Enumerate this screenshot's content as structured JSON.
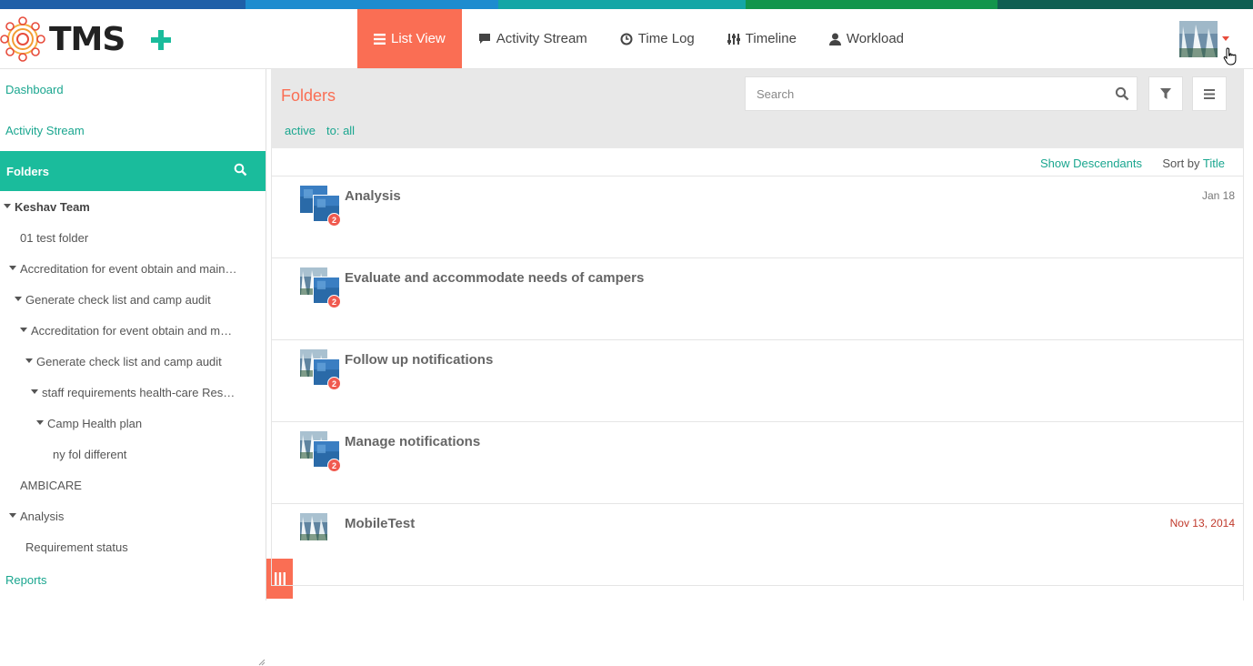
{
  "brand": {
    "name": "TMS"
  },
  "nav": {
    "items": [
      {
        "label": "List View",
        "icon": "list-icon",
        "active": true
      },
      {
        "label": "Activity Stream",
        "icon": "comment-icon",
        "active": false
      },
      {
        "label": "Time Log",
        "icon": "clock-icon",
        "active": false
      },
      {
        "label": "Timeline",
        "icon": "sliders-icon",
        "active": false
      },
      {
        "label": "Workload",
        "icon": "user-icon",
        "active": false
      }
    ]
  },
  "sidebar": {
    "dashboard": "Dashboard",
    "activity_stream": "Activity Stream",
    "folders_title": "Folders",
    "reports": "Reports",
    "tree": [
      {
        "label": "Keshav Team",
        "caret": true,
        "bold": true
      },
      {
        "label": "01 test folder",
        "caret": false
      },
      {
        "label": "Accreditation for event obtain and maintain",
        "caret": true
      },
      {
        "label": "Generate check list and camp audit",
        "caret": true
      },
      {
        "label": "Accreditation for event obtain and maintain",
        "caret": true
      },
      {
        "label": "Generate check list and camp audit",
        "caret": true
      },
      {
        "label": "staff requirements health-care Resources",
        "caret": true
      },
      {
        "label": "Camp Health plan",
        "caret": true
      },
      {
        "label": "ny fol different",
        "caret": false
      },
      {
        "label": "AMBICARE",
        "caret": false
      },
      {
        "label": "Analysis",
        "caret": true
      },
      {
        "label": "Requirement status",
        "caret": false
      }
    ]
  },
  "main": {
    "title": "Folders",
    "search_placeholder": "Search",
    "filters": {
      "status": "active",
      "assignee": "to: all"
    },
    "show_descendants": "Show Descendants",
    "sort_label": "Sort by",
    "sort_value": "Title",
    "rows": [
      {
        "title": "Analysis",
        "date": "Jan 18",
        "badge": "2",
        "overdue": false,
        "stacked": true
      },
      {
        "title": "Evaluate and accommodate needs of campers",
        "date": "",
        "badge": "2",
        "overdue": false,
        "stacked": true
      },
      {
        "title": "Follow up notifications",
        "date": "",
        "badge": "2",
        "overdue": false,
        "stacked": true
      },
      {
        "title": "Manage notifications",
        "date": "",
        "badge": "2",
        "overdue": false,
        "stacked": true
      },
      {
        "title": "MobileTest",
        "date": "Nov 13, 2014",
        "badge": "",
        "overdue": true,
        "stacked": false
      }
    ]
  },
  "colors": {
    "accent": "#fa6e54",
    "teal": "#1abc9c",
    "link": "#1aa68f",
    "strip": [
      "#1f5fa8",
      "#1e8ccf",
      "#14a6a6",
      "#12954c",
      "#0f5e52"
    ]
  }
}
